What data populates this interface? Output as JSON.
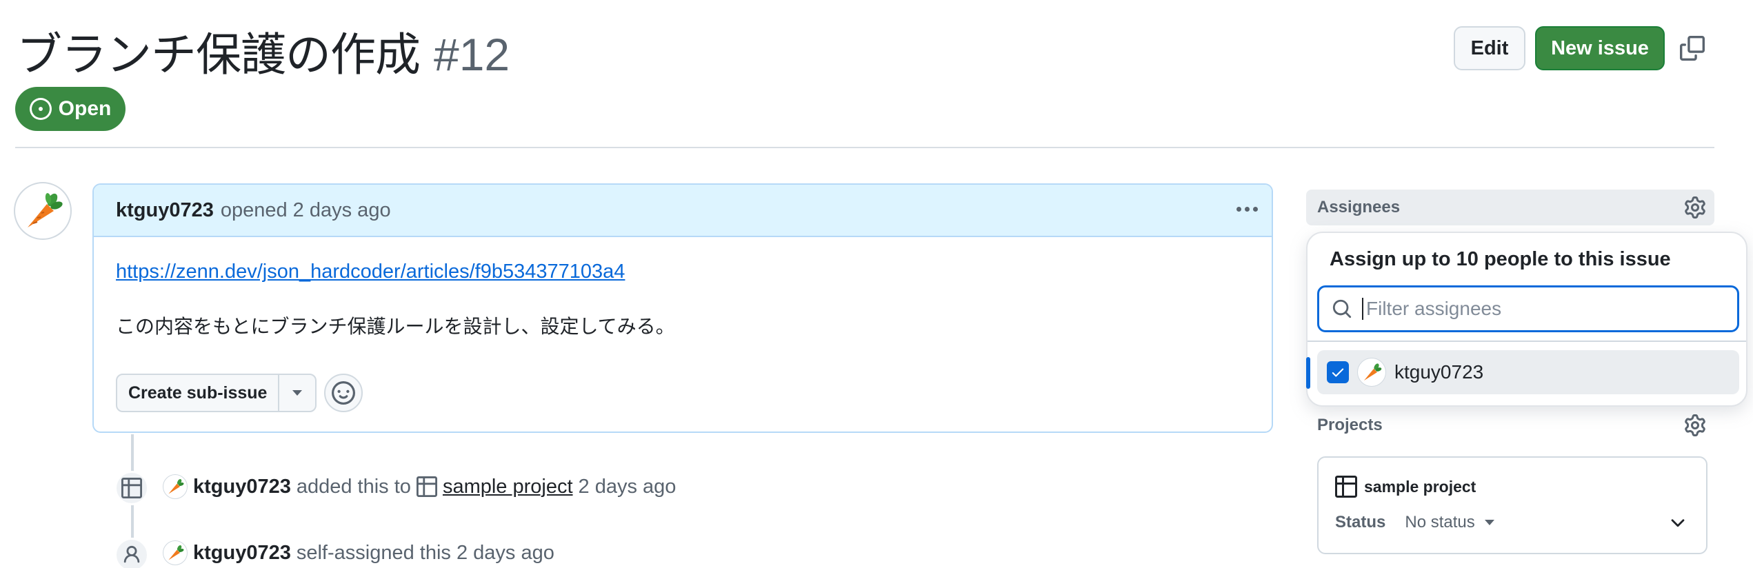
{
  "issue": {
    "title": "ブランチ保護の作成",
    "number": "#12",
    "state": "Open"
  },
  "header": {
    "edit_label": "Edit",
    "new_issue_label": "New issue"
  },
  "comment": {
    "author": "ktguy0723",
    "meta": "opened 2 days ago",
    "link": "https://zenn.dev/json_hardcoder/articles/f9b534377103a4",
    "body": "この内容をもとにブランチ保護ルールを設計し、設定してみる。",
    "create_sub_issue_label": "Create sub-issue"
  },
  "timeline": [
    {
      "user": "ktguy0723",
      "action": "added this to",
      "target": "sample project",
      "time": "2 days ago"
    },
    {
      "user": "ktguy0723",
      "action": "self-assigned this 2 days ago"
    }
  ],
  "sidebar": {
    "assignees_heading": "Assignees",
    "popover_title": "Assign up to 10 people to this issue",
    "filter_placeholder": "Filter assignees",
    "assignee": "ktguy0723",
    "projects_heading": "Projects",
    "project_name": "sample project",
    "status_label": "Status",
    "status_value": "No status"
  },
  "colors": {
    "open_green": "#3a8a42",
    "accent_blue": "#0969da",
    "comment_header_bg": "#ddf4ff"
  }
}
